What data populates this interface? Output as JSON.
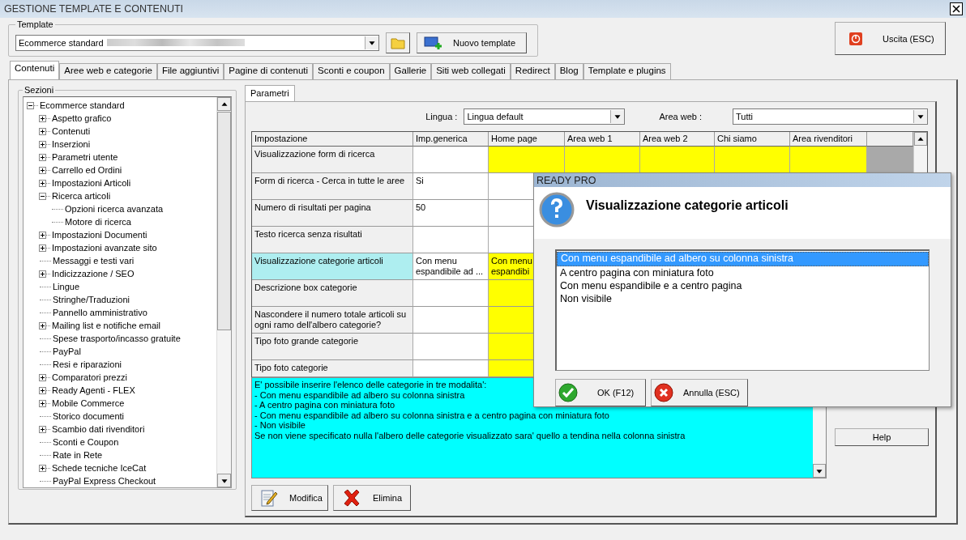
{
  "window": {
    "title": "GESTIONE TEMPLATE E CONTENUTI"
  },
  "template": {
    "legend": "Template",
    "value": "Ecommerce standard",
    "new_button": "Nuovo template"
  },
  "exit_button": "Uscita (ESC)",
  "tabs": [
    {
      "label": "Contenuti",
      "selected": true
    },
    {
      "label": "Aree web e categorie",
      "selected": false
    },
    {
      "label": "File aggiuntivi",
      "selected": false
    },
    {
      "label": "Pagine di contenuti",
      "selected": false
    },
    {
      "label": "Sconti e coupon",
      "selected": false
    },
    {
      "label": "Gallerie",
      "selected": false
    },
    {
      "label": "Siti web collegati",
      "selected": false
    },
    {
      "label": "Redirect",
      "selected": false
    },
    {
      "label": "Blog",
      "selected": false
    },
    {
      "label": "Template e plugins",
      "selected": false
    }
  ],
  "sections": {
    "legend": "Sezioni",
    "tree": [
      {
        "label": "Ecommerce standard",
        "kind": "group",
        "expanded": true,
        "children": [
          {
            "label": "Aspetto grafico",
            "kind": "group",
            "expanded": false
          },
          {
            "label": "Contenuti",
            "kind": "group",
            "expanded": false
          },
          {
            "label": "Inserzioni",
            "kind": "group",
            "expanded": false
          },
          {
            "label": "Parametri utente",
            "kind": "group",
            "expanded": false
          },
          {
            "label": "Carrello ed Ordini",
            "kind": "group",
            "expanded": false
          },
          {
            "label": "Impostazioni Articoli",
            "kind": "group",
            "expanded": false
          },
          {
            "label": "Ricerca articoli",
            "kind": "group",
            "expanded": true,
            "children": [
              {
                "label": "Opzioni ricerca avanzata",
                "kind": "item"
              },
              {
                "label": "Motore di ricerca",
                "kind": "item"
              }
            ]
          },
          {
            "label": "Impostazioni Documenti",
            "kind": "group",
            "expanded": false
          },
          {
            "label": "Impostazioni avanzate sito",
            "kind": "group",
            "expanded": false
          },
          {
            "label": "Messaggi e testi vari",
            "kind": "item"
          },
          {
            "label": "Indicizzazione / SEO",
            "kind": "group",
            "expanded": false
          },
          {
            "label": "Lingue",
            "kind": "item"
          },
          {
            "label": "Stringhe/Traduzioni",
            "kind": "item"
          },
          {
            "label": "Pannello amministrativo",
            "kind": "item"
          },
          {
            "label": "Mailing list e notifiche email",
            "kind": "group",
            "expanded": false
          },
          {
            "label": "Spese trasporto/incasso gratuite",
            "kind": "item"
          },
          {
            "label": "PayPal",
            "kind": "item"
          },
          {
            "label": "Resi e riparazioni",
            "kind": "item"
          },
          {
            "label": "Comparatori prezzi",
            "kind": "group",
            "expanded": false
          },
          {
            "label": "Ready Agenti - FLEX",
            "kind": "group",
            "expanded": false
          },
          {
            "label": "Mobile Commerce",
            "kind": "group",
            "expanded": false
          },
          {
            "label": "Storico documenti",
            "kind": "item"
          },
          {
            "label": "Scambio dati rivenditori",
            "kind": "group",
            "expanded": false
          },
          {
            "label": "Sconti e Coupon",
            "kind": "item"
          },
          {
            "label": "Rate in Rete",
            "kind": "item"
          },
          {
            "label": "Schede tecniche IceCat",
            "kind": "group",
            "expanded": false
          },
          {
            "label": "PayPal Express Checkout",
            "kind": "item"
          }
        ]
      }
    ]
  },
  "inner_tabs": [
    {
      "label": "Parametri",
      "selected": true
    }
  ],
  "filters": [
    {
      "label": "Lingua :",
      "value": "Lingua default"
    },
    {
      "label": "Area web :",
      "value": "Tutti"
    }
  ],
  "table": {
    "columns": [
      "Impostazione",
      "Imp.generica",
      "Home page",
      "Area web 1",
      "Area web 2",
      "Chi siamo",
      "Area rivenditori"
    ],
    "rows": [
      {
        "selected": false,
        "cells": [
          {
            "text": "Visualizzazione form di ricerca"
          },
          {},
          {
            "highlighted": true
          },
          {
            "highlighted": true
          },
          {
            "highlighted": true
          },
          {
            "highlighted": true
          },
          {
            "highlighted": true
          }
        ]
      },
      {
        "selected": false,
        "cells": [
          {
            "text": "Form di ricerca - Cerca in tutte le aree"
          },
          {
            "text": "Si"
          },
          {
            "highlighted": false
          }
        ]
      },
      {
        "selected": false,
        "cells": [
          {
            "text": "Numero di risultati per pagina"
          },
          {
            "text": "50"
          },
          {
            "highlighted": false
          }
        ]
      },
      {
        "selected": false,
        "cells": [
          {
            "text": "Testo ricerca senza risultati"
          },
          {},
          {
            "highlighted": false
          }
        ]
      },
      {
        "selected": true,
        "cells": [
          {
            "text": "Visualizzazione categorie articoli"
          },
          {
            "text": "Con menu espandibile ad ..."
          },
          {
            "highlighted": true,
            "text": "Con menu espandibi"
          }
        ]
      },
      {
        "selected": false,
        "cells": [
          {
            "text": "Descrizione box categorie"
          },
          {},
          {
            "highlighted": true
          }
        ]
      },
      {
        "selected": false,
        "cells": [
          {
            "text": "Nascondere il numero totale articoli su ogni ramo dell'albero categorie?"
          },
          {},
          {
            "highlighted": true
          }
        ]
      },
      {
        "selected": false,
        "cells": [
          {
            "text": "Tipo foto grande categorie"
          },
          {},
          {
            "highlighted": true
          }
        ]
      },
      {
        "selected": false,
        "cells": [
          {
            "text": "Tipo foto categorie"
          },
          {},
          {
            "highlighted": true
          }
        ]
      }
    ]
  },
  "description": "E' possibile inserire l'elenco delle categorie in tre modalita':\n- Con menu espandibile ad albero su colonna sinistra\n- A centro pagina con miniatura foto\n- Con menu espandibile ad albero su colonna sinistra e a centro pagina con miniatura foto\n- Non visibile\nSe non viene specificato nulla l'albero delle categorie visualizzato sara' quello a tendina nella colonna sinistra",
  "help_button": "Help",
  "actions": [
    {
      "label": "Modifica",
      "kind": "edit"
    },
    {
      "label": "Elimina",
      "kind": "delete"
    }
  ],
  "dialog": {
    "title": "READY PRO",
    "heading": "Visualizzazione categorie articoli",
    "options": [
      {
        "label": "Con menu espandibile ad albero su colonna sinistra",
        "selected": true
      },
      {
        "label": "A centro pagina con miniatura foto",
        "selected": false
      },
      {
        "label": "Con menu espandibile e a centro pagina",
        "selected": false
      },
      {
        "label": "Non visibile",
        "selected": false
      }
    ],
    "buttons": [
      {
        "label": "OK (F12)",
        "kind": "ok"
      },
      {
        "label": "Annulla (ESC)",
        "kind": "cancel"
      }
    ]
  }
}
